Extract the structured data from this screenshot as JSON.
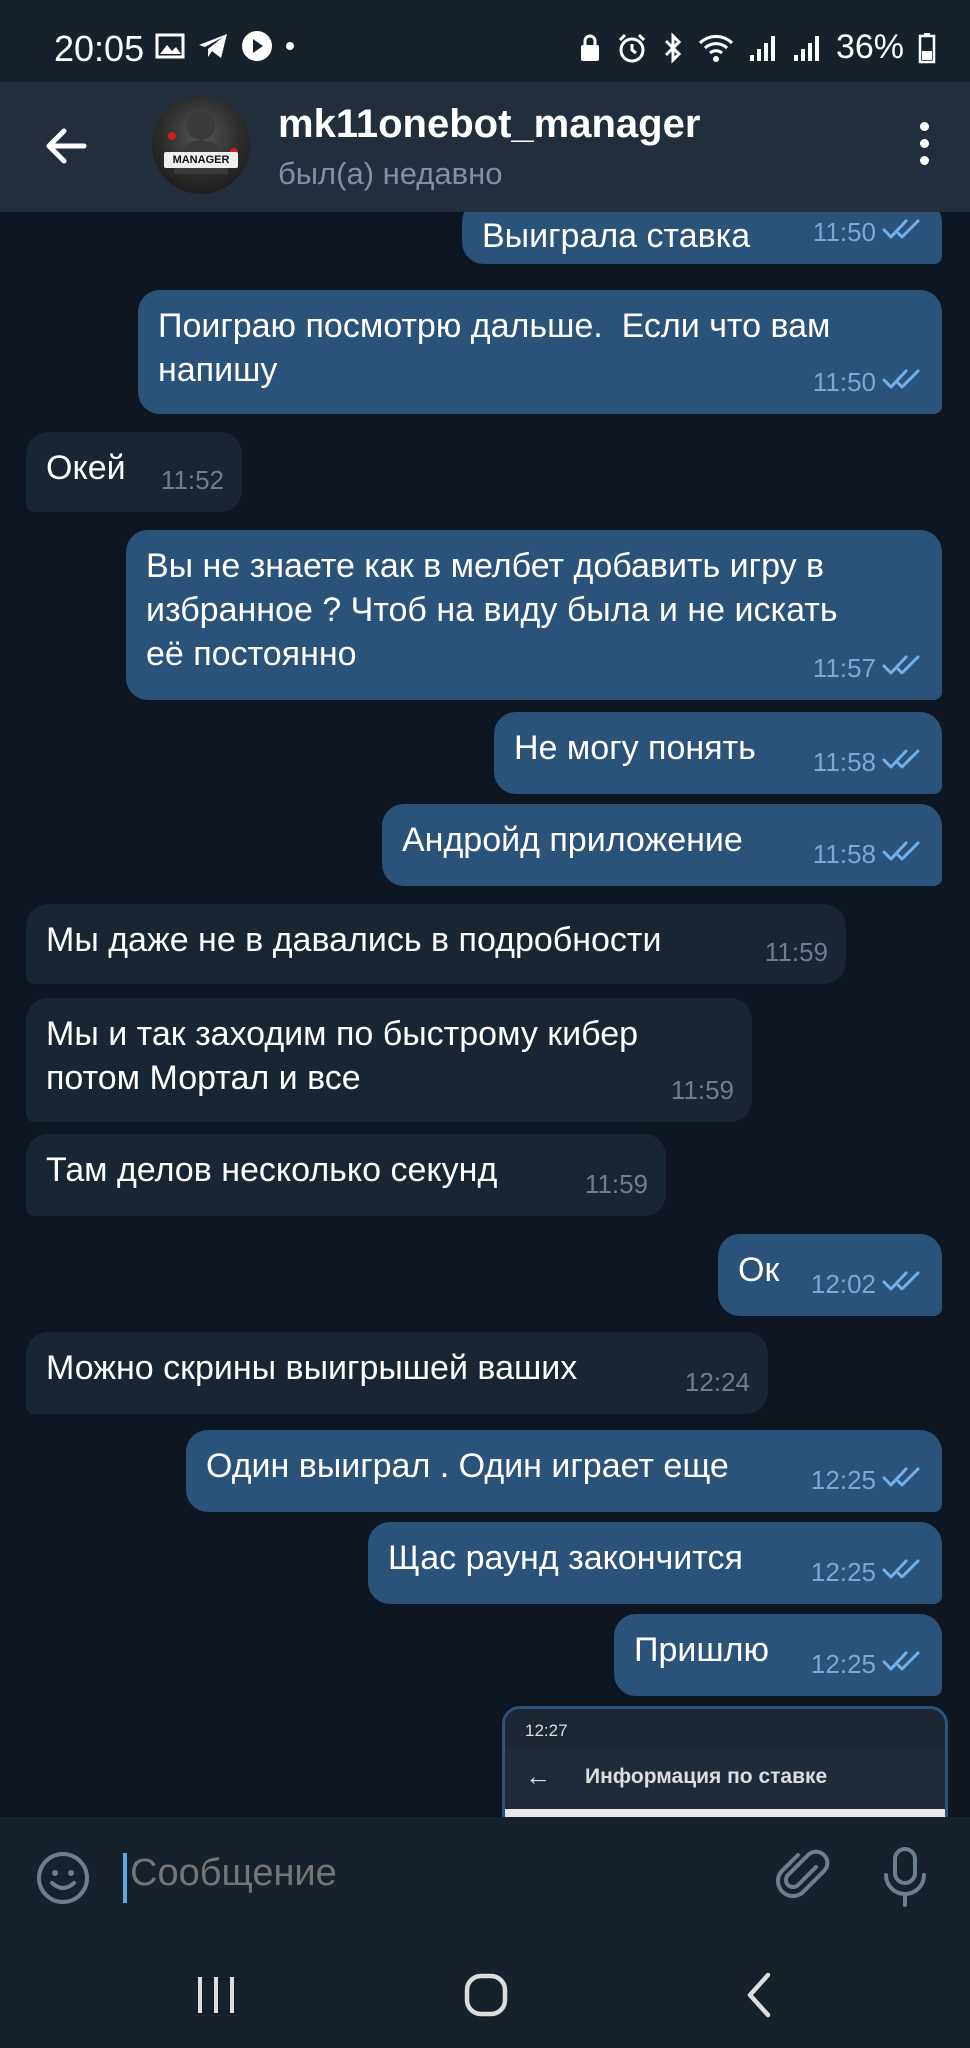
{
  "status_bar": {
    "time": "20:05",
    "battery": "36%"
  },
  "header": {
    "name": "mk11onebot_manager",
    "status": "был(а) недавно",
    "avatar_text": "MANAGER"
  },
  "messages": [
    {
      "dir": "out",
      "text": "Выиграла ставка",
      "time": "11:50"
    },
    {
      "dir": "out",
      "text": "Поиграю посмотрю дальше.  Если что вам\nнапишу",
      "time": "11:50"
    },
    {
      "dir": "in",
      "text": "Окей",
      "time": "11:52"
    },
    {
      "dir": "out",
      "text": "Вы не знаете как в мелбет добавить игру в\nизбранное ? Чтоб на виду была и не искать\nеё постоянно",
      "time": "11:57"
    },
    {
      "dir": "out",
      "text": "Не могу понять",
      "time": "11:58"
    },
    {
      "dir": "out",
      "text": "Андройд приложение",
      "time": "11:58"
    },
    {
      "dir": "in",
      "text": "Мы даже не в давались в подробности",
      "time": "11:59"
    },
    {
      "dir": "in",
      "text": "Мы и так заходим по быстрому кибер\nпотом Мортал и все",
      "time": "11:59"
    },
    {
      "dir": "in",
      "text": "Там делов несколько секунд",
      "time": "11:59"
    },
    {
      "dir": "out",
      "text": "Ок",
      "time": "12:02"
    },
    {
      "dir": "in",
      "text": "Можно скрины выигрышей ваших",
      "time": "12:24"
    },
    {
      "dir": "out",
      "text": "Один выиграл . Один играет еще",
      "time": "12:25"
    },
    {
      "dir": "out",
      "text": "Щас раунд закончится",
      "time": "12:25"
    },
    {
      "dir": "out",
      "text": "Пришлю",
      "time": "12:25"
    }
  ],
  "image_preview": {
    "status_time": "12:27",
    "title": "Информация по ставке"
  },
  "input": {
    "placeholder": "Сообщение"
  }
}
